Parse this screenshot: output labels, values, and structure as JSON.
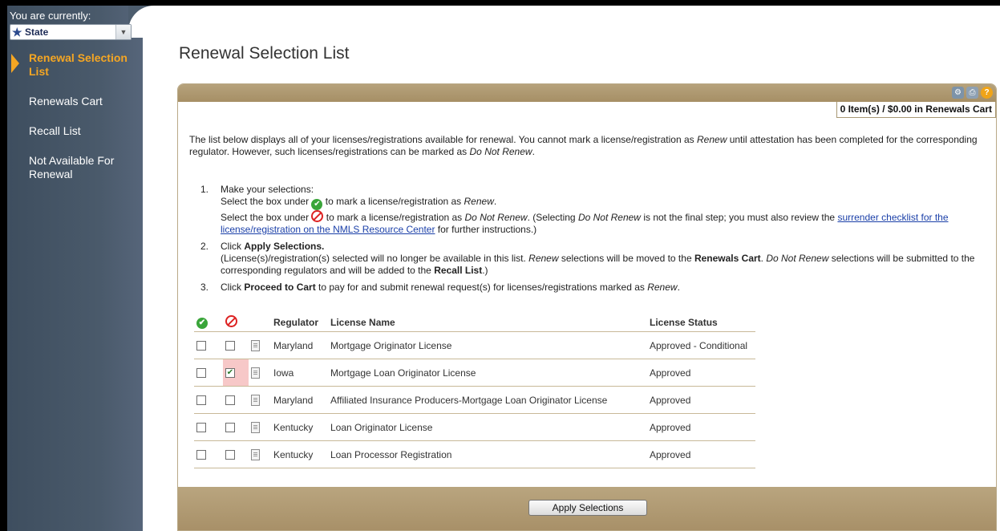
{
  "sidebar": {
    "current_label": "You are currently:",
    "role_select": {
      "value": "State"
    },
    "nav": [
      {
        "label": "Renewal Selection List",
        "active": true
      },
      {
        "label": "Renewals Cart",
        "active": false
      },
      {
        "label": "Recall List",
        "active": false
      },
      {
        "label": "Not Available For Renewal",
        "active": false
      }
    ]
  },
  "page": {
    "title": "Renewal Selection List",
    "cart_summary": "0 Item(s) / $0.00 in Renewals Cart",
    "intro_1": "The list below displays all of your licenses/registrations available for renewal. You cannot mark a license/registration as ",
    "intro_renew": "Renew",
    "intro_2": " until attestation has been completed for the corresponding regulator. However, such licenses/registrations can be marked as ",
    "intro_donot": "Do Not Renew",
    "intro_3": ".",
    "steps": {
      "s1_num": "1.",
      "s1_title": "Make your selections:",
      "s1_a_pre": "Select the box under",
      "s1_a_post": "to mark a license/registration as",
      "s1_a_term": "Renew",
      "s1_b_pre": "Select the box under",
      "s1_b_post": "to mark a license/registration as",
      "s1_b_term": "Do Not Renew",
      "s1_b_note_pre": ". (Selecting ",
      "s1_b_note_term": "Do Not Renew",
      "s1_b_note_mid": " is not the final step; you must also review the ",
      "s1_b_link": "surrender checklist for the license/registration on the NMLS Resource Center",
      "s1_b_note_end": " for further instructions.)",
      "s2_num": "2.",
      "s2_pre": "Click ",
      "s2_bold": "Apply Selections.",
      "s2_line_a": "(License(s)/registration(s) selected will no longer be available in this list. ",
      "s2_renew": "Renew",
      "s2_line_b": " selections will be moved to the ",
      "s2_cart": "Renewals Cart",
      "s2_line_c": ". ",
      "s2_donot": "Do Not Renew",
      "s2_line_d": " selections will be submitted to the corresponding regulators and will be added to the ",
      "s2_recall": "Recall List",
      "s2_line_e": ".)",
      "s3_num": "3.",
      "s3_pre": "Click ",
      "s3_bold": "Proceed to Cart",
      "s3_post": " to pay for and submit renewal request(s) for licenses/registrations marked as ",
      "s3_renew": "Renew",
      "s3_end": "."
    }
  },
  "table": {
    "headers": {
      "regulator": "Regulator",
      "license_name": "License Name",
      "license_status": "License Status"
    },
    "rows": [
      {
        "regulator": "Maryland",
        "license_name": "Mortgage Originator License",
        "status": "Approved - Conditional",
        "renew": false,
        "do_not_renew": false
      },
      {
        "regulator": "Iowa",
        "license_name": "Mortgage Loan Originator License",
        "status": "Approved",
        "renew": false,
        "do_not_renew": true
      },
      {
        "regulator": "Maryland",
        "license_name": "Affiliated Insurance Producers-Mortgage Loan Originator License",
        "status": "Approved",
        "renew": false,
        "do_not_renew": false
      },
      {
        "regulator": "Kentucky",
        "license_name": "Loan Originator License",
        "status": "Approved",
        "renew": false,
        "do_not_renew": false
      },
      {
        "regulator": "Kentucky",
        "license_name": "Loan Processor Registration",
        "status": "Approved",
        "renew": false,
        "do_not_renew": false
      }
    ]
  },
  "buttons": {
    "apply": "Apply Selections"
  },
  "icons": {
    "renew": "green-check-icon",
    "do_not_renew": "red-no-icon",
    "detail": "document-icon",
    "help": "help-icon",
    "print": "print-icon",
    "tools": "tools-icon"
  },
  "colors": {
    "accent": "#f5a623",
    "panel": "#a89068",
    "sidebar": "#4a5a6b",
    "highlight": "#f7c8c8"
  }
}
